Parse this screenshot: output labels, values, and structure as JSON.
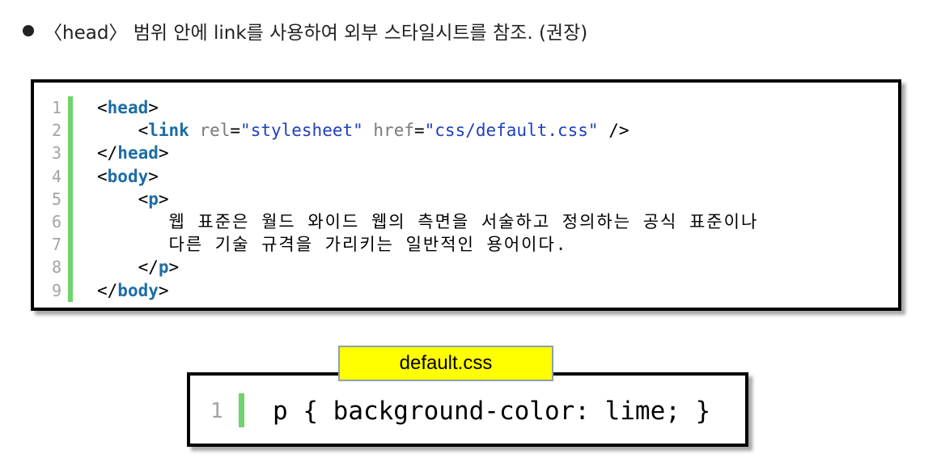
{
  "heading": "〈head〉 범위 안에 link를 사용하여 외부 스타일시트를 참조. (권장)",
  "html_code": {
    "line_numbers": [
      "1",
      "2",
      "3",
      "4",
      "5",
      "6",
      "7",
      "8",
      "9"
    ],
    "lines": [
      {
        "indent": "",
        "parts": [
          {
            "t": "<",
            "c": "p"
          },
          {
            "t": "head",
            "c": "kw"
          },
          {
            "t": ">",
            "c": "p"
          }
        ]
      },
      {
        "indent": "    ",
        "parts": [
          {
            "t": "<",
            "c": "p"
          },
          {
            "t": "link",
            "c": "kw"
          },
          {
            "t": " rel",
            "c": "at"
          },
          {
            "t": "=",
            "c": "p"
          },
          {
            "t": "\"stylesheet\"",
            "c": "st"
          },
          {
            "t": " href",
            "c": "at"
          },
          {
            "t": "=",
            "c": "p"
          },
          {
            "t": "\"css/default.css\"",
            "c": "st"
          },
          {
            "t": " />",
            "c": "p"
          }
        ]
      },
      {
        "indent": "",
        "parts": [
          {
            "t": "</",
            "c": "p"
          },
          {
            "t": "head",
            "c": "kw"
          },
          {
            "t": ">",
            "c": "p"
          }
        ]
      },
      {
        "indent": "",
        "parts": [
          {
            "t": "<",
            "c": "p"
          },
          {
            "t": "body",
            "c": "kw"
          },
          {
            "t": ">",
            "c": "p"
          }
        ]
      },
      {
        "indent": "    ",
        "parts": [
          {
            "t": "<",
            "c": "p"
          },
          {
            "t": "p",
            "c": "kw"
          },
          {
            "t": ">",
            "c": "p"
          }
        ]
      },
      {
        "indent": "       ",
        "parts": [
          {
            "t": "웹 표준은 월드 와이드 웹의 측면을 서술하고 정의하는 공식 표준이나",
            "c": "tx"
          }
        ]
      },
      {
        "indent": "       ",
        "parts": [
          {
            "t": "다른 기술 규격을 가리키는 일반적인 용어이다.",
            "c": "tx"
          }
        ]
      },
      {
        "indent": "    ",
        "parts": [
          {
            "t": "</",
            "c": "p"
          },
          {
            "t": "p",
            "c": "kw"
          },
          {
            "t": ">",
            "c": "p"
          }
        ]
      },
      {
        "indent": "",
        "parts": [
          {
            "t": "</",
            "c": "p"
          },
          {
            "t": "body",
            "c": "kw"
          },
          {
            "t": ">",
            "c": "p"
          }
        ]
      }
    ]
  },
  "css_file": {
    "label": "default.css",
    "line_number": "1",
    "code": "p { background-color: lime; }"
  }
}
